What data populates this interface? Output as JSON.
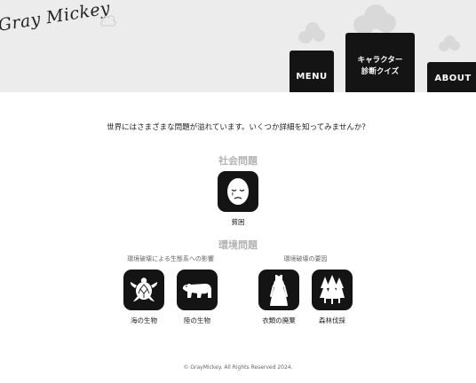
{
  "header": {
    "logo": "Gray Mickey",
    "nav": {
      "menu": "MENU",
      "quiz_line1": "キャラクター",
      "quiz_line2": "診断クイズ",
      "about": "ABOUT"
    }
  },
  "intro": "世界にはさまざまな問題が溢れています。いくつか詳細を知ってみませんか？",
  "social": {
    "title": "社会問題",
    "items": [
      {
        "label": "貧困",
        "icon": "crying-face-icon"
      }
    ]
  },
  "environment": {
    "title": "環境問題",
    "ecosystem": {
      "title": "環境破壊による生態系への影響",
      "items": [
        {
          "label": "海の生物",
          "icon": "sea-turtle-icon"
        },
        {
          "label": "陸の生物",
          "icon": "polar-bear-icon"
        }
      ]
    },
    "causes": {
      "title": "環境破壊の要因",
      "items": [
        {
          "label": "衣類の廃棄",
          "icon": "dress-icon"
        },
        {
          "label": "森林伐採",
          "icon": "trees-icon"
        }
      ]
    }
  },
  "footer": "© GrayMickey. All Rights Reserved 2024.",
  "colors": {
    "header_bg": "#ececec",
    "tile_bg": "#141414",
    "section_title": "#b3b3b3"
  }
}
